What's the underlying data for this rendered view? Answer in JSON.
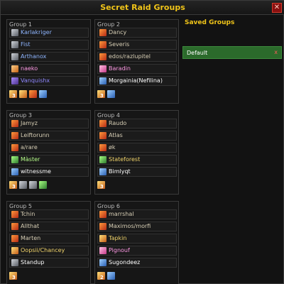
{
  "window": {
    "title": "Secret Raid Groups",
    "close_label": "✕"
  },
  "saved_groups": {
    "title": "Saved Groups",
    "items": [
      {
        "label": "Default",
        "remove_label": "x"
      }
    ]
  },
  "groups": [
    {
      "title": "Group 1",
      "members": [
        {
          "name": "Karlakriger",
          "icon": "shield-class-icon",
          "color": "#8fb6ff"
        },
        {
          "name": "Fist",
          "icon": "shield-class-icon",
          "color": "#8fb6ff"
        },
        {
          "name": "Arthanox",
          "icon": "shield-class-icon",
          "color": "#8fb6ff"
        },
        {
          "name": "naeko",
          "icon": "fire-class-icon",
          "color": "#ff9ae5"
        },
        {
          "name": "Vanquishx",
          "icon": "arcane-class-icon",
          "color": "#8f87ff"
        }
      ],
      "buff_count": "3",
      "buffs": [
        "rally-buff-icon",
        "strength-buff-icon",
        "frost-buff-icon"
      ]
    },
    {
      "title": "Group 2",
      "members": [
        {
          "name": "Dancy",
          "icon": "warrior-class-icon",
          "color": "#d8cfb6"
        },
        {
          "name": "Severis",
          "icon": "warrior-class-icon",
          "color": "#d8cfb6"
        },
        {
          "name": "edos/razlupitel",
          "icon": "warrior-class-icon",
          "color": "#d8cfb6"
        },
        {
          "name": "Baradin",
          "icon": "paladin-class-icon",
          "color": "#ff9ae5"
        },
        {
          "name": "Morgainia(Nefilina)",
          "icon": "frost-class-icon",
          "color": "#ffffff"
        }
      ],
      "buff_count": "3",
      "buffs": [
        "ice-buff-icon"
      ]
    },
    {
      "title": "Group 3",
      "members": [
        {
          "name": "Jamyz",
          "icon": "warrior-class-icon",
          "color": "#d8cfb6"
        },
        {
          "name": "Leiftorunn",
          "icon": "warrior-class-icon",
          "color": "#d8cfb6"
        },
        {
          "name": "a/rare",
          "icon": "warrior-class-icon",
          "color": "#d8cfb6"
        },
        {
          "name": "Màster",
          "icon": "hunter-class-icon",
          "color": "#b7ff8a"
        },
        {
          "name": "witnessme",
          "icon": "shaman-class-icon",
          "color": "#ffffff"
        }
      ],
      "buff_count": "3",
      "buffs": [
        "feather-buff-icon",
        "ghost-wolf-buff-icon",
        "poison-buff-icon"
      ]
    },
    {
      "title": "Group 4",
      "members": [
        {
          "name": "Raudo",
          "icon": "warrior-class-icon",
          "color": "#d8cfb6"
        },
        {
          "name": "Atlas",
          "icon": "warrior-class-icon",
          "color": "#d8cfb6"
        },
        {
          "name": "øk",
          "icon": "warrior-class-icon",
          "color": "#d8cfb6"
        },
        {
          "name": "Stateforest",
          "icon": "hunter-class-icon",
          "color": "#f0d36a"
        },
        {
          "name": "Bimlyqt",
          "icon": "shaman-class-icon",
          "color": "#ffffff"
        }
      ],
      "buff_count": "3",
      "buffs": []
    },
    {
      "title": "Group 5",
      "members": [
        {
          "name": "Tchin",
          "icon": "warrior-class-icon",
          "color": "#d8cfb6"
        },
        {
          "name": "Allthat",
          "icon": "warrior-class-icon",
          "color": "#d8cfb6"
        },
        {
          "name": "Marten",
          "icon": "warrior-class-icon",
          "color": "#d8cfb6"
        },
        {
          "name": "Oopsii/Chancey",
          "icon": "rogue-class-icon",
          "color": "#f0d36a"
        },
        {
          "name": "Standup",
          "icon": "priest-class-icon",
          "color": "#ffffff"
        }
      ],
      "buff_count": "3",
      "buffs": []
    },
    {
      "title": "Group 6",
      "members": [
        {
          "name": "marrshal",
          "icon": "warrior-class-icon",
          "color": "#d8cfb6"
        },
        {
          "name": "Maximos/morfi",
          "icon": "warrior-class-icon",
          "color": "#d8cfb6"
        },
        {
          "name": "Tapkin",
          "icon": "rogue-class-icon",
          "color": "#f0d36a"
        },
        {
          "name": "Pignouf",
          "icon": "paladin-class-icon",
          "color": "#ff9ae5"
        },
        {
          "name": "Sugondeez",
          "icon": "frost-class-icon",
          "color": "#ffffff"
        }
      ],
      "buff_count": "2",
      "buffs": [
        "ice-buff-icon"
      ]
    }
  ]
}
